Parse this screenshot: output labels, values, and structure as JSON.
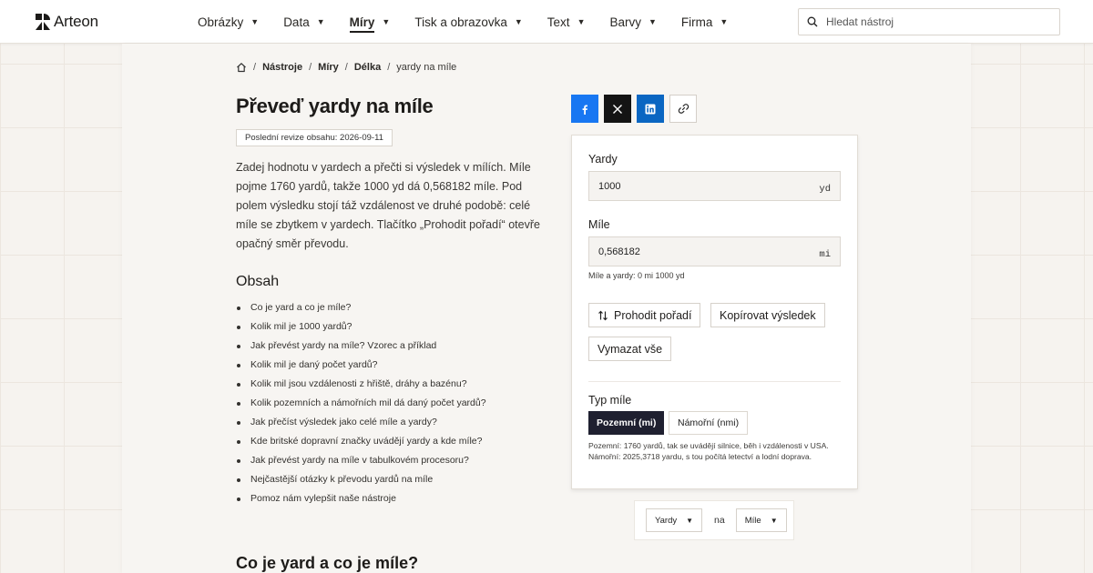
{
  "brand": {
    "name": "Arteon"
  },
  "nav": [
    {
      "label": "Obrázky",
      "active": false
    },
    {
      "label": "Data",
      "active": false
    },
    {
      "label": "Míry",
      "active": true
    },
    {
      "label": "Tisk a obrazovka",
      "active": false
    },
    {
      "label": "Text",
      "active": false
    },
    {
      "label": "Barvy",
      "active": false
    },
    {
      "label": "Firma",
      "active": false
    }
  ],
  "search": {
    "placeholder": "Hledat nástroj"
  },
  "breadcrumb": {
    "items": [
      "Nástroje",
      "Míry",
      "Délka"
    ],
    "current": "yardy na míle",
    "separator": "/"
  },
  "page": {
    "title": "Převeď yardy na míle",
    "revision": "Poslední revize obsahu: 2026-09-11",
    "intro": "Zadej hodnotu v yardech a přečti si výsledek v mílích. Míle pojme 1760 yardů, takže 1000 yd dá 0,568182 míle. Pod polem výsledku stojí táž vzdálenost ve druhé podobě: celé míle se zbytkem v yardech. Tlačítko „Prohodit pořadí“ otevře opačný směr převodu."
  },
  "toc": {
    "title": "Obsah",
    "items": [
      "Co je yard a co je míle?",
      "Kolik mil je 1000 yardů?",
      "Jak převést yardy na míle? Vzorec a příklad",
      "Kolik mil je daný počet yardů?",
      "Kolik mil jsou vzdálenosti z hřiště, dráhy a bazénu?",
      "Kolik pozemních a námořních mil dá daný počet yardů?",
      "Jak přečíst výsledek jako celé míle a yardy?",
      "Kde britské dopravní značky uvádějí yardy a kde míle?",
      "Jak převést yardy na míle v tabulkovém procesoru?",
      "Nejčastější otázky k převodu yardů na míle",
      "Pomoz nám vylepšit naše nástroje"
    ]
  },
  "section": {
    "first_heading": "Co je yard a co je míle?"
  },
  "converter": {
    "input_label": "Yardy",
    "input_value": "1000",
    "input_unit": "yd",
    "output_label": "Míle",
    "output_value": "0,568182",
    "output_unit": "mi",
    "mixed_note": "Míle a yardy: 0 mi 1000 yd",
    "swap_label": "Prohodit pořadí",
    "copy_label": "Kopírovat výsledek",
    "clear_label": "Vymazat vše",
    "mile_type_label": "Typ míle",
    "mile_options": [
      "Pozemní (mi)",
      "Námořní (nmi)"
    ],
    "mile_selected": "Pozemní (mi)",
    "mile_note": "Pozemní: 1760 yardů, tak se uvádějí silnice, běh i vzdálenosti v USA. Námořní: 2025,3718 yardu, s tou počítá letectví a lodní doprava."
  },
  "unit_switch": {
    "from": "Yardy",
    "joiner": "na",
    "to": "Míle"
  },
  "colors": {
    "facebook": "#1877f2",
    "x": "#141414",
    "linkedin": "#0a66c2",
    "segment_active": "#1f2030"
  },
  "icons": {
    "share": [
      "facebook-icon",
      "x-icon",
      "linkedin-icon",
      "link-icon"
    ],
    "search": "search-icon",
    "home": "home-icon",
    "swap": "swap-vertical-icon"
  }
}
